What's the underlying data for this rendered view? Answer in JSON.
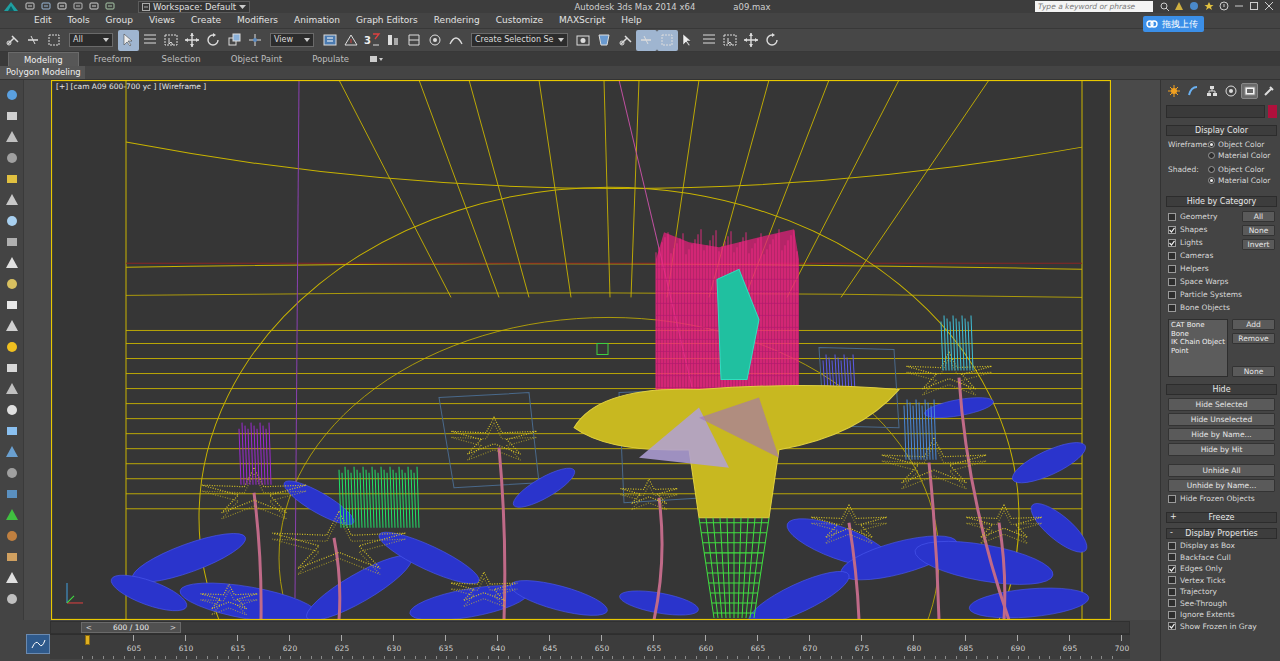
{
  "title_bar": {
    "workspace": "Workspace: Default",
    "app": "Autodesk 3ds Max  2014 x64",
    "file": "a09.max",
    "search_placeholder": "Type a keyword or phrase",
    "upload_button": "拖拽上传"
  },
  "menu": [
    "Edit",
    "Tools",
    "Group",
    "Views",
    "Create",
    "Modifiers",
    "Animation",
    "Graph Editors",
    "Rendering",
    "Customize",
    "MAXScript",
    "Help"
  ],
  "toolbar": {
    "items": [
      {
        "kind": "icon",
        "selected": false
      },
      {
        "kind": "icon",
        "selected": false
      },
      {
        "kind": "icon",
        "selected": false
      },
      {
        "kind": "dropdown",
        "value": "All"
      },
      {
        "kind": "icon",
        "selected": true
      },
      {
        "kind": "icon",
        "selected": false
      },
      {
        "kind": "icon",
        "selected": false
      },
      {
        "kind": "icon",
        "selected": false
      },
      {
        "kind": "icon",
        "selected": false
      },
      {
        "kind": "icon",
        "selected": false
      },
      {
        "kind": "icon",
        "selected": false
      },
      {
        "kind": "dropdown",
        "value": "View"
      },
      {
        "kind": "icon",
        "selected": false
      },
      {
        "kind": "icon",
        "selected": false
      },
      {
        "kind": "snap",
        "value": "3"
      },
      {
        "kind": "icon",
        "selected": false
      },
      {
        "kind": "icon",
        "selected": false
      },
      {
        "kind": "icon",
        "selected": false
      },
      {
        "kind": "icon",
        "selected": false
      },
      {
        "kind": "dropdown",
        "value": "Create Selection Se"
      },
      {
        "kind": "icon",
        "selected": false
      },
      {
        "kind": "icon",
        "selected": false
      },
      {
        "kind": "icon",
        "selected": false
      },
      {
        "kind": "icon",
        "selected": true
      },
      {
        "kind": "icon",
        "selected": true
      },
      {
        "kind": "icon",
        "selected": false
      },
      {
        "kind": "icon",
        "selected": false
      },
      {
        "kind": "icon",
        "selected": false
      },
      {
        "kind": "icon",
        "selected": false
      },
      {
        "kind": "icon",
        "selected": false
      }
    ]
  },
  "ribbon": {
    "tabs": [
      {
        "label": "Modeling",
        "selected": true
      },
      {
        "label": "Freeform",
        "selected": false
      },
      {
        "label": "Selection",
        "selected": false
      },
      {
        "label": "Object Paint",
        "selected": false
      },
      {
        "label": "Populate",
        "selected": false
      }
    ],
    "panel": "Polygon Modeling"
  },
  "viewport": {
    "label": "[+] [cam A09 600-700 yc ] [Wireframe ]"
  },
  "command_panel": {
    "tabs": [
      {
        "selected": false
      },
      {
        "selected": false
      },
      {
        "selected": false
      },
      {
        "selected": false
      },
      {
        "selected": true
      },
      {
        "selected": false
      }
    ],
    "display_color": {
      "title": "Display Color",
      "wireframe": {
        "label": "Wireframe:",
        "options": [
          {
            "label": "Object Color",
            "selected": true
          },
          {
            "label": "Material Color",
            "selected": false
          }
        ]
      },
      "shaded": {
        "label": "Shaded:",
        "options": [
          {
            "label": "Object Color",
            "selected": false
          },
          {
            "label": "Material Color",
            "selected": true
          }
        ]
      }
    },
    "hide_by_category": {
      "title": "Hide by Category",
      "items": [
        {
          "label": "Geometry",
          "checked": false
        },
        {
          "label": "Shapes",
          "checked": true
        },
        {
          "label": "Lights",
          "checked": true
        },
        {
          "label": "Cameras",
          "checked": false
        },
        {
          "label": "Helpers",
          "checked": false
        },
        {
          "label": "Space Warps",
          "checked": false
        },
        {
          "label": "Particle Systems",
          "checked": false
        },
        {
          "label": "Bone Objects",
          "checked": false
        }
      ],
      "buttons": [
        "All",
        "None",
        "Invert"
      ],
      "list": [
        "CAT Bone",
        "Bone",
        "IK Chain Object",
        "Point"
      ],
      "list_buttons": [
        "Add",
        "Remove",
        "None"
      ]
    },
    "hide": {
      "title": "Hide",
      "buttons": [
        "Hide Selected",
        "Hide Unselected",
        "Hide by Name...",
        "Hide by Hit",
        "Unhide All",
        "Unhide by Name..."
      ],
      "checkbox": {
        "label": "Hide Frozen Objects",
        "checked": false
      }
    },
    "freeze": {
      "title": "Freeze",
      "sign": "+"
    },
    "display_properties": {
      "title": "Display Properties",
      "sign": "-",
      "items": [
        {
          "label": "Display as Box",
          "checked": false
        },
        {
          "label": "Backface Cull",
          "checked": false
        },
        {
          "label": "Edges Only",
          "checked": true
        },
        {
          "label": "Vertex Ticks",
          "checked": false
        },
        {
          "label": "Trajectory",
          "checked": false
        },
        {
          "label": "See-Through",
          "checked": false
        },
        {
          "label": "Ignore Extents",
          "checked": false
        },
        {
          "label": "Show Frozen in Gray",
          "checked": true
        }
      ]
    }
  },
  "timeline": {
    "slider": "600 / 100",
    "prev": "<",
    "next": ">",
    "level": 0,
    "ticks": [
      "605",
      "610",
      "615",
      "620",
      "625",
      "630",
      "635",
      "640",
      "645",
      "650",
      "655",
      "660",
      "665",
      "670",
      "675",
      "680",
      "685",
      "690",
      "695",
      "700"
    ]
  }
}
